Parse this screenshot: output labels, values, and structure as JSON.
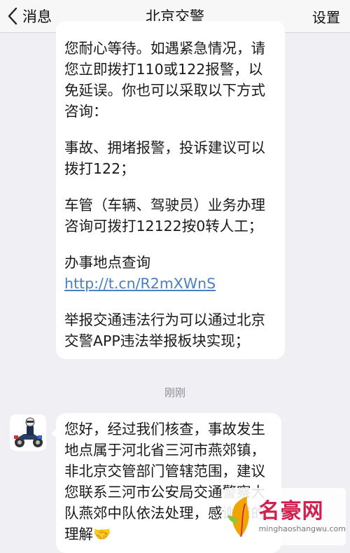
{
  "navbar": {
    "back_label": "消息",
    "title": "北京交警",
    "settings_label": "设置"
  },
  "messages": [
    {
      "paragraphs": [
        "您耐心等待。如遇紧急情况，请您立即拨打110或122报警，以免延误。你也可以采取以下方式咨询：",
        "事故、拥堵报警，投诉建议可以拨打122；",
        "车管（车辆、驾驶员）业务办理咨询可拨打12122按0转人工；"
      ],
      "link_prefix": "办事地点查询 ",
      "link_text": "http://t.cn/R2mXWnS",
      "last_paragraph": "举报交通违法行为可以通过北京交警APP违法举报板块实现；"
    }
  ],
  "timestamp": "刚刚",
  "reply": {
    "text": "您好，经过我们核查，事故发生地点属于河北省三河市燕郊镇，非北京交管部门管辖范围，建议您联系三河市公安局交通警察大队燕郊中队依法处理，感谢您的理解",
    "emoji": "🤝"
  },
  "watermark": {
    "name": "名豪网",
    "url": "minghaoshangwu.com"
  },
  "colors": {
    "link": "#4a7fc0",
    "background": "#efeff4",
    "watermark": "#d21f4e"
  }
}
